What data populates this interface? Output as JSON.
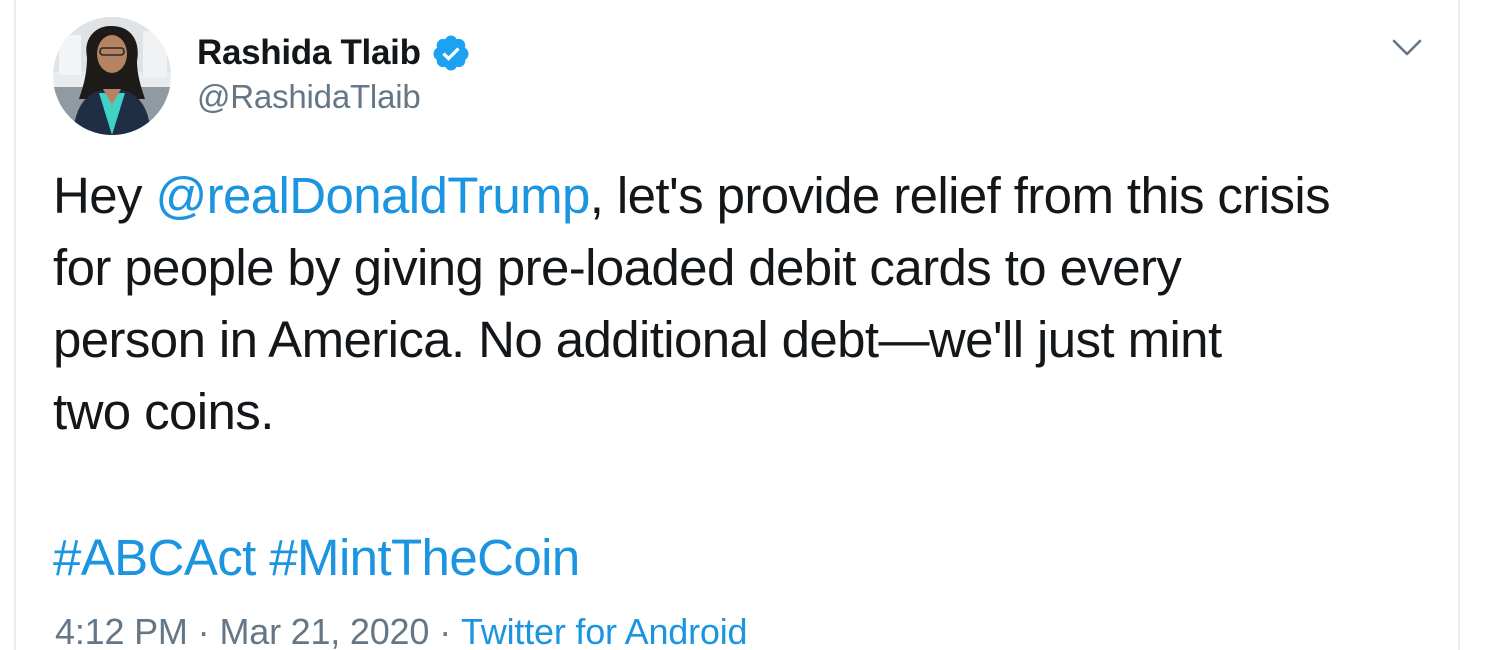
{
  "author": {
    "name": "Rashida Tlaib",
    "handle": "@RashidaTlaib",
    "verified": true,
    "avatar_icon": "profile-photo"
  },
  "tweet": {
    "lines": [
      {
        "before": "Hey ",
        "mention": "@realDonaldTrump",
        "after": ", let's provide relief from this crisis"
      },
      {
        "text": "for people by giving pre-loaded debit cards to every"
      },
      {
        "text": "person in America. No additional debt—we'll just mint"
      },
      {
        "text": "two coins."
      }
    ],
    "hashtags": [
      "#ABCAct",
      "#MintTheCoin"
    ],
    "time": "4:12 PM",
    "date": "Mar 21, 2020",
    "separator": "·",
    "source": "Twitter for Android"
  },
  "icons": {
    "more": "chevron-down-icon",
    "verified": "verified-badge-icon"
  },
  "colors": {
    "link": "#1b95e0",
    "text": "#14171a",
    "secondary": "#657786",
    "verified": "#1da1f2"
  }
}
